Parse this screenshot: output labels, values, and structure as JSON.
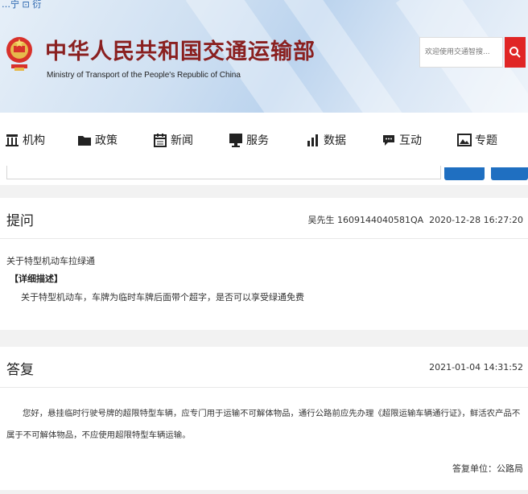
{
  "header": {
    "top_link": "…宁 ⊡ 衍",
    "site_title": "中华人民共和国交通运输部",
    "site_subtitle": "Ministry of Transport of the People's Republic of China",
    "search_placeholder": "欢迎使用交通智搜...",
    "search_icon": "search-icon"
  },
  "nav": {
    "items": [
      {
        "label": "机构",
        "icon": "building-icon"
      },
      {
        "label": "政策",
        "icon": "folder-icon"
      },
      {
        "label": "新闻",
        "icon": "calendar-icon"
      },
      {
        "label": "服务",
        "icon": "monitor-icon"
      },
      {
        "label": "数据",
        "icon": "bar-chart-icon"
      },
      {
        "label": "互动",
        "icon": "chat-icon"
      },
      {
        "label": "专题",
        "icon": "image-icon"
      }
    ]
  },
  "question": {
    "heading": "提问",
    "author_meta": "吴先生 1609144040581QA",
    "time": "2020-12-28 16:27:20",
    "subject": "关于特型机动车拉绿通",
    "detail_label": "【详细描述】",
    "detail_text": "关于特型机动车，车牌为临时车牌后面带个超字，是否可以享受绿通免费"
  },
  "answer": {
    "heading": "答复",
    "time": "2021-01-04 14:31:52",
    "body": "您好，悬挂临时行驶号牌的超限特型车辆，应专门用于运输不可解体物品，通行公路前应先办理《超限运输车辆通行证》，鲜活农产品不属于不可解体物品，不应使用超限特型车辆运输。",
    "unit": "答复单位：公路局"
  },
  "colors": {
    "title_red": "#8a2020",
    "search_red": "#e02525",
    "button_blue": "#1f6fc1"
  }
}
